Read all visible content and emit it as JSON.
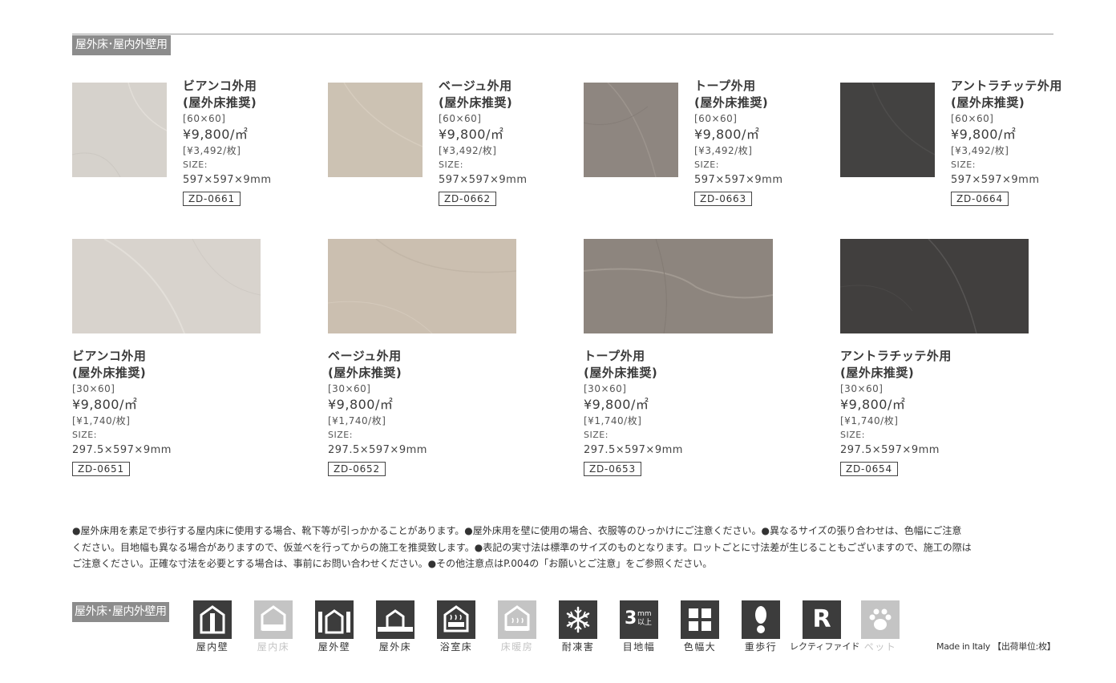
{
  "section_tag": "屋外床･屋内外壁用",
  "products_square": [
    {
      "name_line1": "ビアンコ外用",
      "name_line2": "(屋外床推奨)",
      "format": "[60×60]",
      "price": "¥9,800/㎡",
      "unit_price": "[¥3,492/枚]",
      "size_label": "SIZE:",
      "size": "597×597×9mm",
      "code": "ZD-0661",
      "color": "#d6d2cc"
    },
    {
      "name_line1": "ベージュ外用",
      "name_line2": "(屋外床推奨)",
      "format": "[60×60]",
      "price": "¥9,800/㎡",
      "unit_price": "[¥3,492/枚]",
      "size_label": "SIZE:",
      "size": "597×597×9mm",
      "code": "ZD-0662",
      "color": "#ccc2b3"
    },
    {
      "name_line1": "トープ外用",
      "name_line2": "(屋外床推奨)",
      "format": "[60×60]",
      "price": "¥9,800/㎡",
      "unit_price": "[¥3,492/枚]",
      "size_label": "SIZE:",
      "size": "597×597×9mm",
      "code": "ZD-0663",
      "color": "#8e8680"
    },
    {
      "name_line1": "アントラチッテ外用",
      "name_line2": "(屋外床推奨)",
      "format": "[60×60]",
      "price": "¥9,800/㎡",
      "unit_price": "[¥3,492/枚]",
      "size_label": "SIZE:",
      "size": "597×597×9mm",
      "code": "ZD-0664",
      "color": "#434241"
    }
  ],
  "products_rect": [
    {
      "name_line1": "ビアンコ外用",
      "name_line2": "(屋外床推奨)",
      "format": "[30×60]",
      "price": "¥9,800/㎡",
      "unit_price": "[¥1,740/枚]",
      "size_label": "SIZE:",
      "size": "297.5×597×9mm",
      "code": "ZD-0651",
      "color": "#d8d3cd"
    },
    {
      "name_line1": "ベージュ外用",
      "name_line2": "(屋外床推奨)",
      "format": "[30×60]",
      "price": "¥9,800/㎡",
      "unit_price": "[¥1,740/枚]",
      "size_label": "SIZE:",
      "size": "297.5×597×9mm",
      "code": "ZD-0652",
      "color": "#cbbfb0"
    },
    {
      "name_line1": "トープ外用",
      "name_line2": "(屋外床推奨)",
      "format": "[30×60]",
      "price": "¥9,800/㎡",
      "unit_price": "[¥1,740/枚]",
      "size_label": "SIZE:",
      "size": "297.5×597×9mm",
      "code": "ZD-0653",
      "color": "#8d857e"
    },
    {
      "name_line1": "アントラチッテ外用",
      "name_line2": "(屋外床推奨)",
      "format": "[30×60]",
      "price": "¥9,800/㎡",
      "unit_price": "[¥1,740/枚]",
      "size_label": "SIZE:",
      "size": "297.5×597×9mm",
      "code": "ZD-0654",
      "color": "#413f3e"
    }
  ],
  "notes": {
    "line1": "●屋外床用を素足で歩行する屋内床に使用する場合、靴下等が引っかかることがあります。●屋外床用を壁に使用の場合、衣服等のひっかけにご注意ください。●異なるサイズの張り合わせは、色幅にご注意",
    "line2": "ください。目地幅も異なる場合がありますので、仮並べを行ってからの施工を推奨致します。●表記の実寸法は標準のサイズのものとなります。ロットごとに寸法差が生じることもございますので、施工の際は",
    "line3": "ご注意ください。正確な寸法を必要とする場合は、事前にお問い合わせください。●その他注意点はP.004の「お願いとご注意」をご参照ください。"
  },
  "legend": {
    "tag": "屋外床･屋内外壁用",
    "items": [
      {
        "label": "屋内壁",
        "icon": "indoor-wall-icon",
        "active": true
      },
      {
        "label": "屋内床",
        "icon": "indoor-floor-icon",
        "active": false
      },
      {
        "label": "屋外壁",
        "icon": "outdoor-wall-icon",
        "active": true
      },
      {
        "label": "屋外床",
        "icon": "outdoor-floor-icon",
        "active": true
      },
      {
        "label": "浴室床",
        "icon": "bathroom-floor-icon",
        "active": true
      },
      {
        "label": "床暖房",
        "icon": "floor-heating-icon",
        "active": false
      },
      {
        "label": "耐凍害",
        "icon": "frost-resistant-icon",
        "active": true
      },
      {
        "label": "目地幅",
        "icon": "joint-width-icon",
        "active": true,
        "icon_text_big": "3",
        "icon_text_small_top": "mm",
        "icon_text_small_bottom": "以上"
      },
      {
        "label": "色幅大",
        "icon": "color-variation-icon",
        "active": true
      },
      {
        "label": "重歩行",
        "icon": "heavy-traffic-icon",
        "active": true
      },
      {
        "label": "レクティファイド",
        "icon": "rectified-icon",
        "active": true,
        "icon_text_big": "R"
      },
      {
        "label": "ペット",
        "icon": "pet-icon",
        "active": false
      }
    ]
  },
  "footer": {
    "made_in": "Made in Italy",
    "shipping_unit": "【出荷単位:枚】"
  },
  "colors": {
    "icon_active": "#3c3c3c",
    "icon_inactive": "#c4c4c4",
    "tag_bg": "#8c8c8c"
  }
}
